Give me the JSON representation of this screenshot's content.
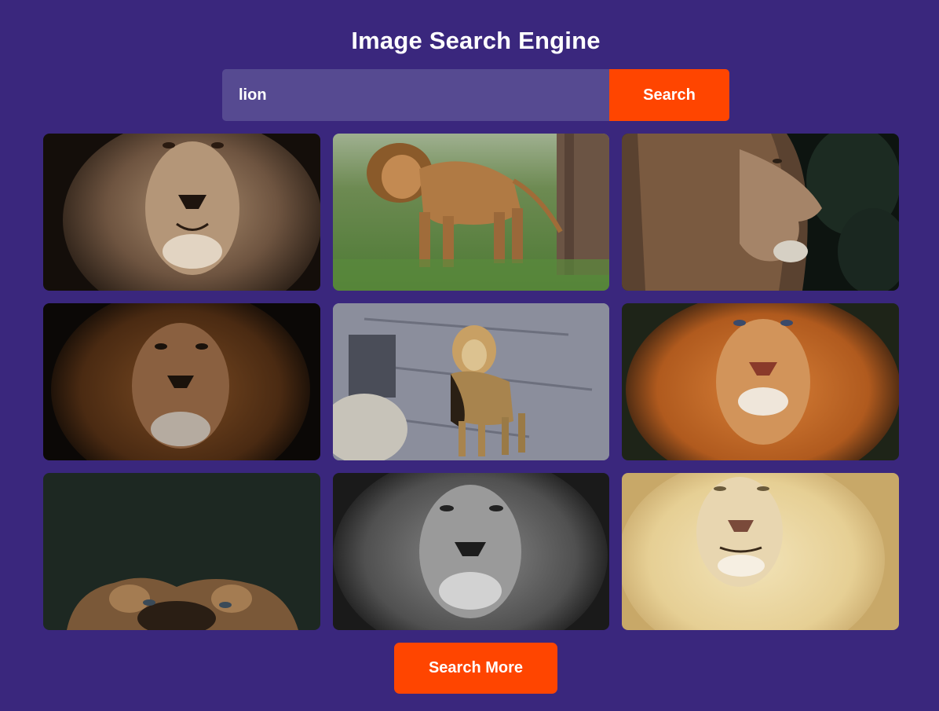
{
  "header": {
    "title": "Image Search Engine"
  },
  "search": {
    "query": "lion",
    "button_label": "Search"
  },
  "results": {
    "count": 9,
    "images": [
      {
        "subject": "sepia-lion-face"
      },
      {
        "subject": "lion-walking-on-grass"
      },
      {
        "subject": "lion-profile-dark-foliage"
      },
      {
        "subject": "dark-maned-lion-face"
      },
      {
        "subject": "lion-standing-on-rocks"
      },
      {
        "subject": "orange-lion-face"
      },
      {
        "subject": "lion-head-peeking-up-dark"
      },
      {
        "subject": "black-and-white-lion-face"
      },
      {
        "subject": "white-lion-face"
      }
    ]
  },
  "footer": {
    "more_label": "Search More"
  },
  "colors": {
    "background": "#3a277d",
    "input": "#564a91",
    "accent": "#ff4500",
    "text": "#ffffff"
  }
}
